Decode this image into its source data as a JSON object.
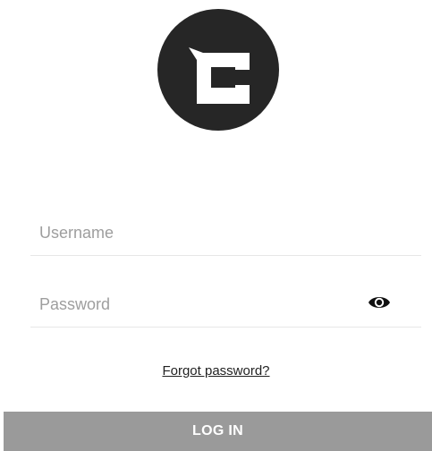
{
  "logo": {
    "icon": "brand-c-logo-icon",
    "background_color": "#262626",
    "glyph_color": "#ffffff"
  },
  "form": {
    "username": {
      "placeholder": "Username",
      "value": ""
    },
    "password": {
      "placeholder": "Password",
      "value": "",
      "visibility_icon": "eye-icon"
    },
    "forgot_password_label": "Forgot password?",
    "login_label": "LOG IN"
  },
  "colors": {
    "login_button": "#9a9a9a",
    "divider": "#e7e7e7",
    "placeholder_text": "#9e9e9e"
  }
}
